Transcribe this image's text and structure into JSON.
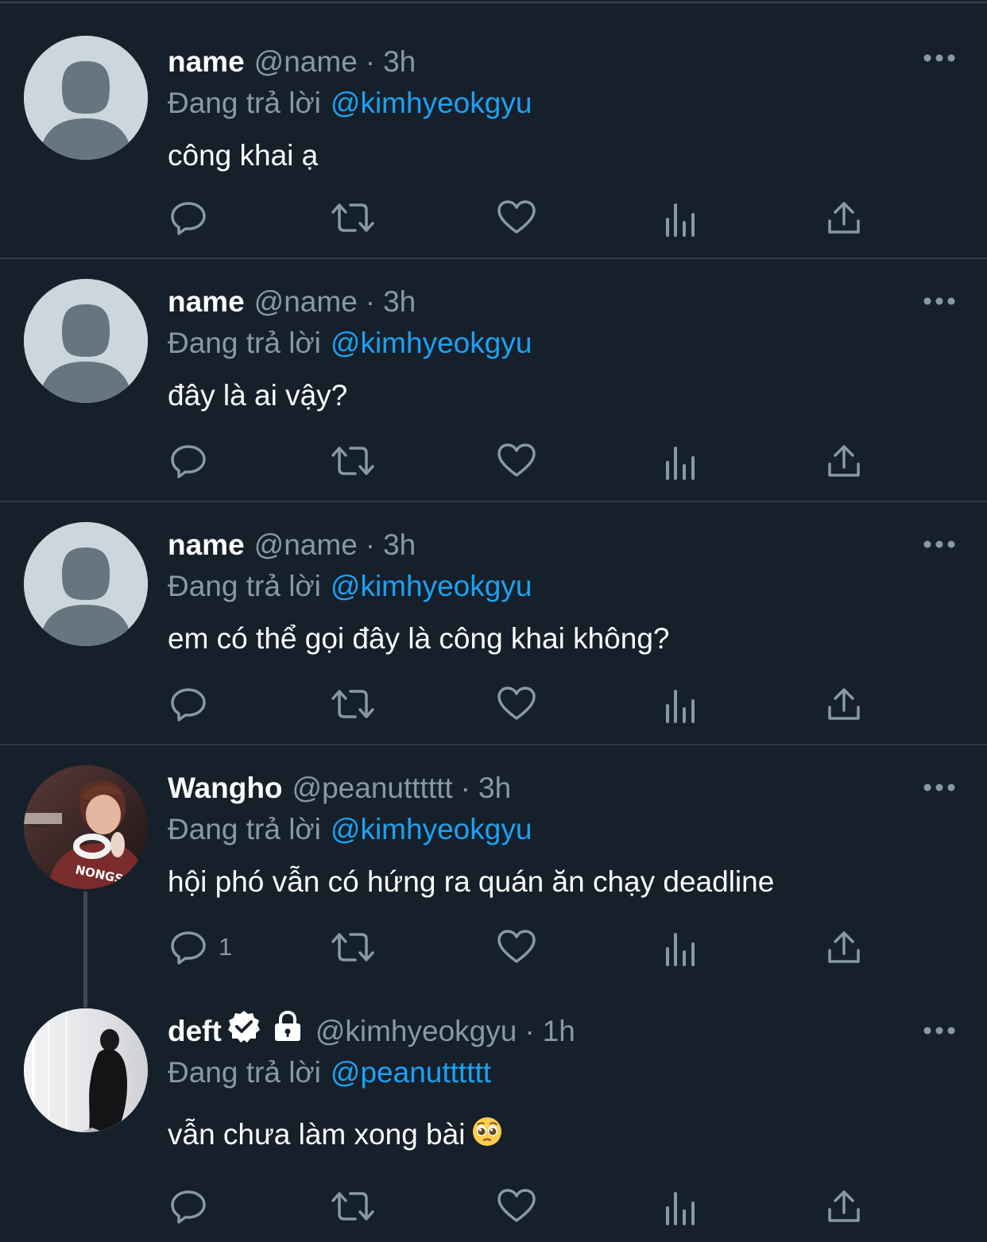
{
  "tweets": [
    {
      "display_name": "name",
      "handle": "@name",
      "separator": "·",
      "time": "3h",
      "reply_prefix": "Đang trả lời",
      "reply_to": "@kimhyeokgyu",
      "text": "công khai ạ",
      "reply_count": "",
      "avatar": "default-avatar-icon"
    },
    {
      "display_name": "name",
      "handle": "@name",
      "separator": "·",
      "time": "3h",
      "reply_prefix": "Đang trả lời",
      "reply_to": "@kimhyeokgyu",
      "text": "đây là ai vậy?",
      "reply_count": "",
      "avatar": "default-avatar-icon"
    },
    {
      "display_name": "name",
      "handle": "@name",
      "separator": "·",
      "time": "3h",
      "reply_prefix": "Đang trả lời",
      "reply_to": "@kimhyeokgyu",
      "text": "em có thể gọi đây là công khai không?",
      "reply_count": "",
      "avatar": "default-avatar-icon"
    },
    {
      "display_name": "Wangho",
      "handle": "@peanutttttt",
      "separator": "·",
      "time": "3h",
      "reply_prefix": "Đang trả lời",
      "reply_to": "@kimhyeokgyu",
      "text": "hội phó vẫn có hứng ra quán ăn chạy deadline",
      "reply_count": "1",
      "avatar": "user-photo-avatar",
      "avatar_text": "NONGSHI"
    },
    {
      "display_name": "deft",
      "handle": "@kimhyeokgyu",
      "separator": "·",
      "time": "1h",
      "reply_prefix": "Đang trả lời",
      "reply_to": "@peanutttttt",
      "text": "vẫn chưa làm xong bài",
      "reply_count": "",
      "avatar": "user-photo-avatar",
      "verified": true,
      "protected": true,
      "text_emoji": "pleading-face-emoji"
    }
  ],
  "colors": {
    "background": "#15202b",
    "divider": "#2f3b45",
    "primary_text": "#ffffff",
    "secondary_text": "#8899a6",
    "link": "#1da1f2",
    "icon": "#8899a6"
  },
  "icons": {
    "reply": "reply-icon",
    "retweet": "retweet-icon",
    "like": "like-icon",
    "views": "views-icon",
    "share": "share-icon",
    "more": "more-icon"
  }
}
